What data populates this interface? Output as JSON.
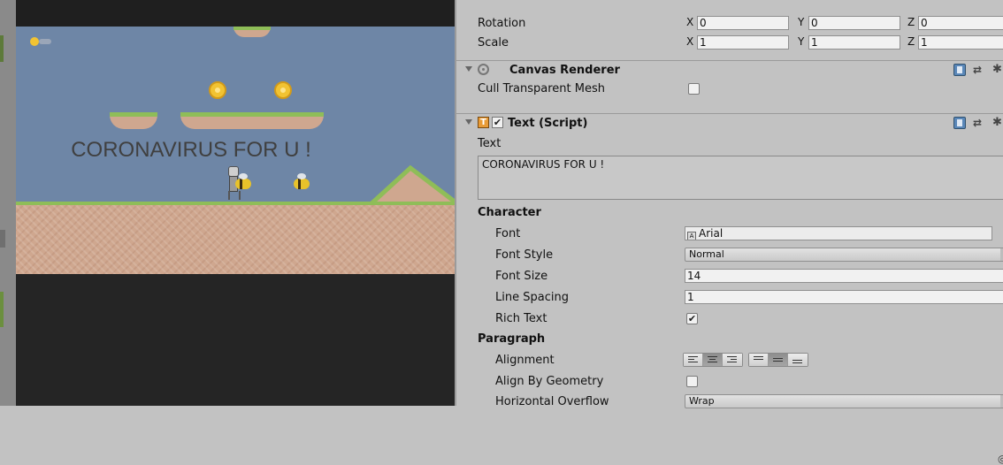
{
  "game_view": {
    "text": "CORONAVIRUS FOR U !"
  },
  "inspector": {
    "transform": {
      "rotation": {
        "label": "Rotation",
        "x": "0",
        "y": "0",
        "z": "0"
      },
      "scale": {
        "label": "Scale",
        "x": "1",
        "y": "1",
        "z": "1"
      },
      "axis_labels": {
        "x": "X",
        "y": "Y",
        "z": "Z"
      }
    },
    "canvas_renderer": {
      "title": "Canvas Renderer",
      "cull_label": "Cull Transparent Mesh",
      "cull_checked": false
    },
    "text_script": {
      "title": "Text (Script)",
      "enabled": true,
      "text_label": "Text",
      "text_value": "CORONAVIRUS FOR U !",
      "character_header": "Character",
      "font_label": "Font",
      "font_value": "Arial",
      "font_style_label": "Font Style",
      "font_style_value": "Normal",
      "font_size_label": "Font Size",
      "font_size_value": "14",
      "line_spacing_label": "Line Spacing",
      "line_spacing_value": "1",
      "rich_text_label": "Rich Text",
      "rich_text_checked": true,
      "paragraph_header": "Paragraph",
      "alignment_label": "Alignment",
      "align_by_geometry_label": "Align By Geometry",
      "align_by_geometry_checked": false,
      "horizontal_overflow_label": "Horizontal Overflow",
      "horizontal_overflow_value": "Wrap"
    }
  },
  "glyphs": {
    "check": "✔",
    "text_icon": "T",
    "preset": "⇄",
    "gear": "✱",
    "target": "◎",
    "font_icon": "A"
  }
}
